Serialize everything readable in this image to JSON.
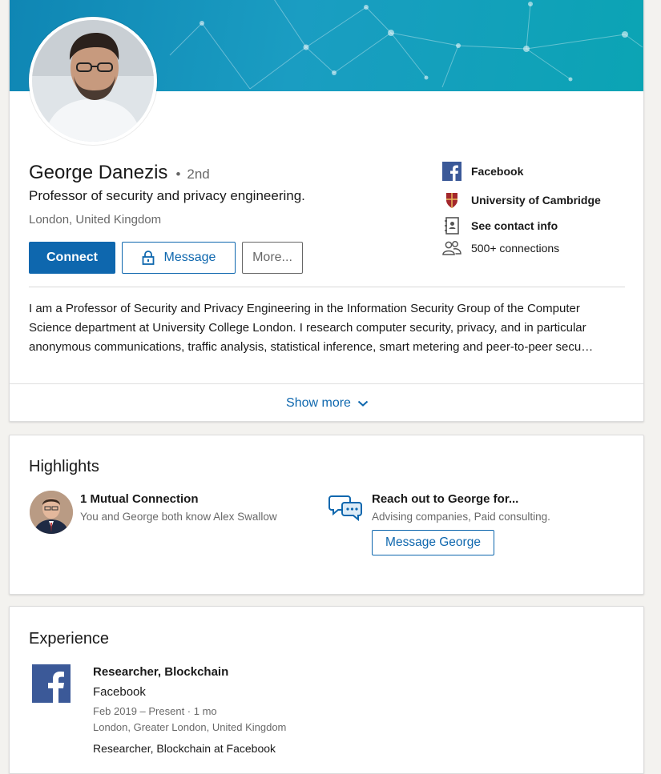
{
  "colors": {
    "brand_blue": "#0e67ae",
    "banner": "#1a9dc2",
    "facebook": "#3b5998",
    "cambridge": "#a3272c"
  },
  "profile": {
    "name": "George Danezis",
    "degree_bullet": "•",
    "degree": "2nd",
    "headline": "Professor of security and privacy engineering.",
    "location": "London, United Kingdom",
    "actions": {
      "connect_label": "Connect",
      "message_label": "Message",
      "more_label": "More..."
    },
    "side_info": [
      {
        "icon": "facebook-icon",
        "label": "Facebook"
      },
      {
        "icon": "cambridge-crest-icon",
        "label": "University of Cambridge"
      },
      {
        "icon": "contact-card-icon",
        "label": "See contact info"
      },
      {
        "icon": "people-icon",
        "label": "500+ connections"
      }
    ],
    "summary_lines": [
      "I am a Professor of Security and Privacy Engineering in the Information Security Group of the Computer",
      "Science department at University College London. I research computer security, privacy, and in particular",
      "anonymous communications, traffic analysis, statistical inference, smart metering and peer-to-peer secu…"
    ],
    "show_more_label": "Show more"
  },
  "highlights": {
    "title": "Highlights",
    "mutual": {
      "title": "1 Mutual Connection",
      "subtitle": "You and George both know Alex Swallow"
    },
    "reach_out": {
      "title": "Reach out to George for...",
      "subtitle": "Advising companies, Paid consulting.",
      "button_label": "Message George"
    }
  },
  "experience": {
    "title": "Experience",
    "items": [
      {
        "role": "Researcher, Blockchain",
        "company": "Facebook",
        "dates": "Feb 2019 – Present · 1 mo",
        "location": "London, Greater London, United Kingdom",
        "description": "Researcher, Blockchain at Facebook"
      }
    ]
  }
}
